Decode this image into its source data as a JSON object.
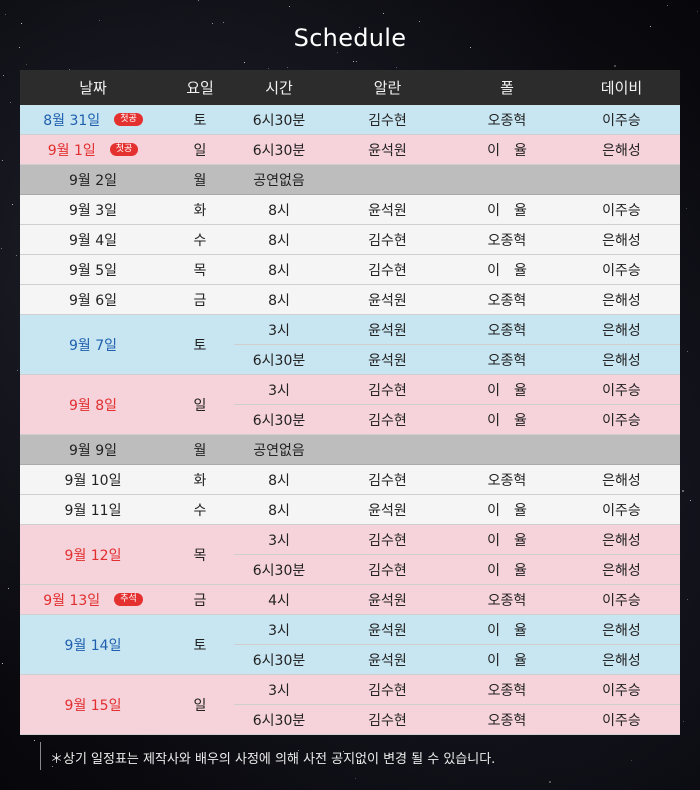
{
  "title": "Schedule",
  "headers": [
    "날짜",
    "요일",
    "시간",
    "알란",
    "폴",
    "데이비"
  ],
  "rows": [
    {
      "color": "blue",
      "date": "8월 31일",
      "tag": "첫공",
      "day": "토",
      "time": "6시30분",
      "alan": "김수현",
      "pole": "오종혁",
      "davy": "이주승",
      "span": 1
    },
    {
      "color": "pink",
      "date": "9월 1일",
      "tag": "첫공",
      "day": "일",
      "time": "6시30분",
      "alan": "윤석원",
      "pole": "이　율",
      "davy": "은해성",
      "span": 1
    },
    {
      "color": "gray",
      "date": "9월 2일",
      "tag": "",
      "day": "월",
      "time": "공연없음",
      "alan": "",
      "pole": "",
      "davy": "",
      "span": 1,
      "notime": true
    },
    {
      "color": "white",
      "date": "9월 3일",
      "tag": "",
      "day": "화",
      "time": "8시",
      "alan": "윤석원",
      "pole": "이　율",
      "davy": "이주승",
      "span": 1
    },
    {
      "color": "white",
      "date": "9월 4일",
      "tag": "",
      "day": "수",
      "time": "8시",
      "alan": "김수현",
      "pole": "오종혁",
      "davy": "은해성",
      "span": 1
    },
    {
      "color": "white",
      "date": "9월 5일",
      "tag": "",
      "day": "목",
      "time": "8시",
      "alan": "김수현",
      "pole": "이　율",
      "davy": "이주승",
      "span": 1
    },
    {
      "color": "white",
      "date": "9월 6일",
      "tag": "",
      "day": "금",
      "time": "8시",
      "alan": "윤석원",
      "pole": "오종혁",
      "davy": "은해성",
      "span": 1
    },
    {
      "color": "blue",
      "date": "9월 7일",
      "tag": "",
      "day": "토",
      "time": "3시",
      "alan": "윤석원",
      "pole": "오종혁",
      "davy": "은해성",
      "span": 2
    },
    {
      "color": "blue",
      "time": "6시30분",
      "alan": "윤석원",
      "pole": "오종혁",
      "davy": "은해성",
      "sub": true
    },
    {
      "color": "pink",
      "date": "9월 8일",
      "tag": "",
      "day": "일",
      "time": "3시",
      "alan": "김수현",
      "pole": "이　율",
      "davy": "이주승",
      "span": 2
    },
    {
      "color": "pink",
      "time": "6시30분",
      "alan": "김수현",
      "pole": "이　율",
      "davy": "이주승",
      "sub": true
    },
    {
      "color": "gray",
      "date": "9월 9일",
      "tag": "",
      "day": "월",
      "time": "공연없음",
      "alan": "",
      "pole": "",
      "davy": "",
      "span": 1,
      "notime": true
    },
    {
      "color": "white",
      "date": "9월 10일",
      "tag": "",
      "day": "화",
      "time": "8시",
      "alan": "김수현",
      "pole": "오종혁",
      "davy": "은해성",
      "span": 1
    },
    {
      "color": "white",
      "date": "9월 11일",
      "tag": "",
      "day": "수",
      "time": "8시",
      "alan": "윤석원",
      "pole": "이　율",
      "davy": "이주승",
      "span": 1
    },
    {
      "color": "pink",
      "date": "9월 12일",
      "tag": "",
      "day": "목",
      "time": "3시",
      "alan": "김수현",
      "pole": "이　율",
      "davy": "은해성",
      "span": 2
    },
    {
      "color": "pink",
      "time": "6시30분",
      "alan": "김수현",
      "pole": "이　율",
      "davy": "은해성",
      "sub": true
    },
    {
      "color": "pink",
      "date": "9월 13일",
      "tag": "추석",
      "day": "금",
      "time": "4시",
      "alan": "윤석원",
      "pole": "오종혁",
      "davy": "이주승",
      "span": 1
    },
    {
      "color": "blue",
      "date": "9월 14일",
      "tag": "",
      "day": "토",
      "time": "3시",
      "alan": "윤석원",
      "pole": "이　율",
      "davy": "은해성",
      "span": 2
    },
    {
      "color": "blue",
      "time": "6시30분",
      "alan": "윤석원",
      "pole": "이　율",
      "davy": "은해성",
      "sub": true
    },
    {
      "color": "pink",
      "date": "9월 15일",
      "tag": "",
      "day": "일",
      "time": "3시",
      "alan": "김수현",
      "pole": "오종혁",
      "davy": "이주승",
      "span": 2
    },
    {
      "color": "pink",
      "time": "6시30분",
      "alan": "김수현",
      "pole": "오종혁",
      "davy": "이주승",
      "sub": true
    }
  ],
  "note": "＊상기 일정표는 제작사와 배우의 사정에 의해 사전 공지없이 변경 될 수 있습니다."
}
